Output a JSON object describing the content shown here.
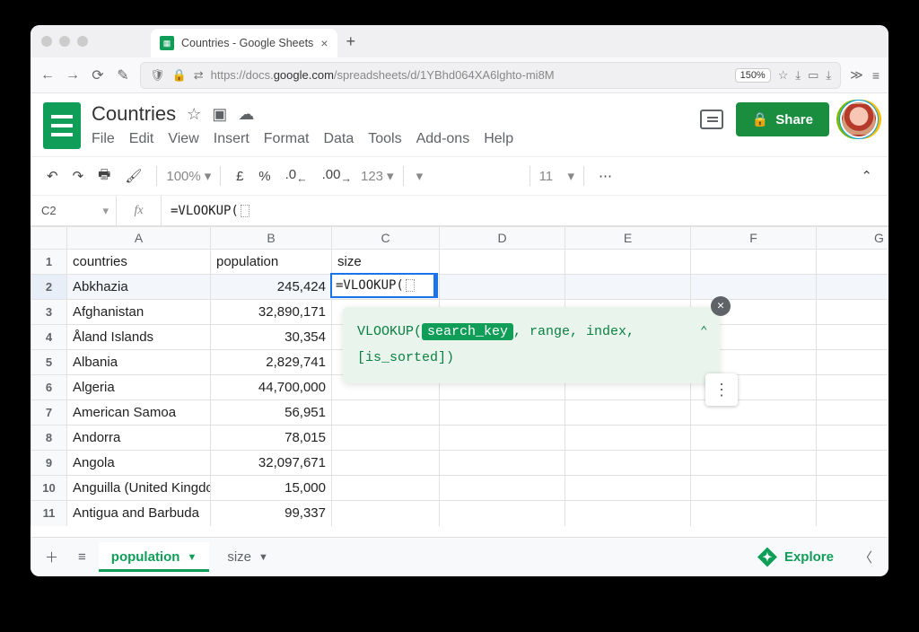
{
  "browser": {
    "tab_title": "Countries - Google Sheets",
    "url_plain_prefix": "https://docs.",
    "url_host": "google.com",
    "url_path": "/spreadsheets/d/1YBhd064XA6lghto-mi8M",
    "zoom": "150%"
  },
  "doc": {
    "title": "Countries",
    "menus": [
      "File",
      "Edit",
      "View",
      "Insert",
      "Format",
      "Data",
      "Tools",
      "Add-ons",
      "Help"
    ],
    "share_label": "Share"
  },
  "toolbar": {
    "zoom": "100%",
    "currency": "£",
    "percent": "%",
    "dec_dec": ".0",
    "dec_inc": ".00",
    "more_fmt": "123",
    "font_size": "11"
  },
  "formula_bar": {
    "cell_ref": "C2",
    "fx": "fx",
    "formula": "=VLOOKUP("
  },
  "grid": {
    "col_headers": [
      "A",
      "B",
      "C",
      "D",
      "E",
      "F",
      "G"
    ],
    "header_row": {
      "a": "countries",
      "b": "population",
      "c": "size"
    },
    "rows": [
      {
        "n": "1"
      },
      {
        "n": "2",
        "a": "Abkhazia",
        "b": "245,424",
        "c_formula": "=VLOOKUP("
      },
      {
        "n": "3",
        "a": "Afghanistan",
        "b": "32,890,171"
      },
      {
        "n": "4",
        "a": "Åland Islands",
        "b": "30,354"
      },
      {
        "n": "5",
        "a": "Albania",
        "b": "2,829,741"
      },
      {
        "n": "6",
        "a": "Algeria",
        "b": "44,700,000"
      },
      {
        "n": "7",
        "a": "American Samoa",
        "b": "56,951"
      },
      {
        "n": "8",
        "a": "Andorra",
        "b": "78,015"
      },
      {
        "n": "9",
        "a": "Angola",
        "b": "32,097,671"
      },
      {
        "n": "10",
        "a": "Anguilla (United Kingdom)",
        "b": "15,000"
      },
      {
        "n": "11",
        "a": "Antigua and Barbuda",
        "b": "99,337"
      }
    ]
  },
  "tooltip": {
    "fn": "VLOOKUP(",
    "cur_arg": "search_key",
    "rest": ", range, index,",
    "line2": "[is_sorted])"
  },
  "sheets": {
    "active": "population",
    "other": "size",
    "explore": "Explore"
  }
}
